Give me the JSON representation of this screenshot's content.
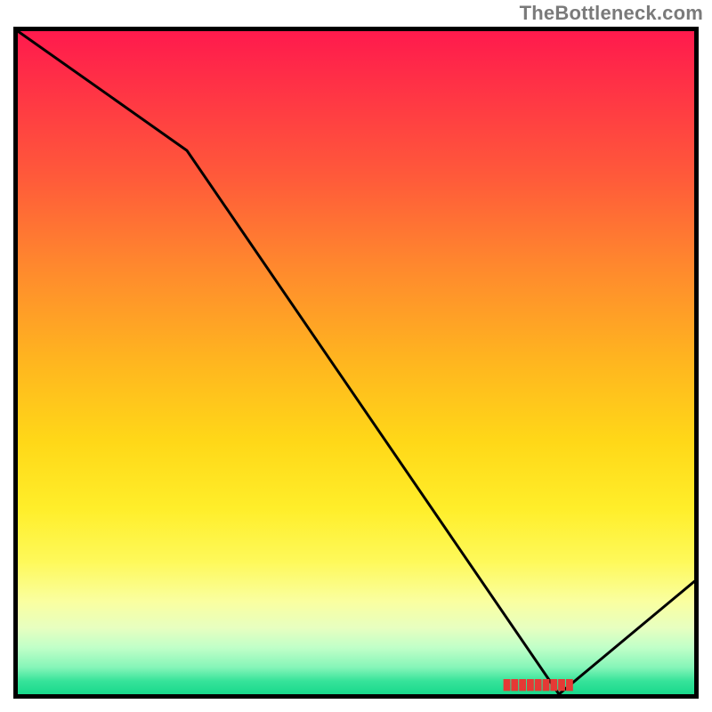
{
  "watermark": "TheBottleneck.com",
  "chart_data": {
    "type": "line",
    "title": "",
    "xlabel": "",
    "ylabel": "",
    "x": [
      0,
      25,
      80,
      100
    ],
    "values": [
      100,
      82,
      0,
      17
    ],
    "ylim": [
      0,
      100
    ],
    "xlim": [
      0,
      100
    ],
    "x_tick": {
      "position_pct": 77,
      "label_obscured": true
    },
    "colors": {
      "top": "#ff1a4d",
      "mid": "#ffd818",
      "bottom": "#18d98c",
      "line": "#000000"
    },
    "grid": false,
    "legend": false
  }
}
